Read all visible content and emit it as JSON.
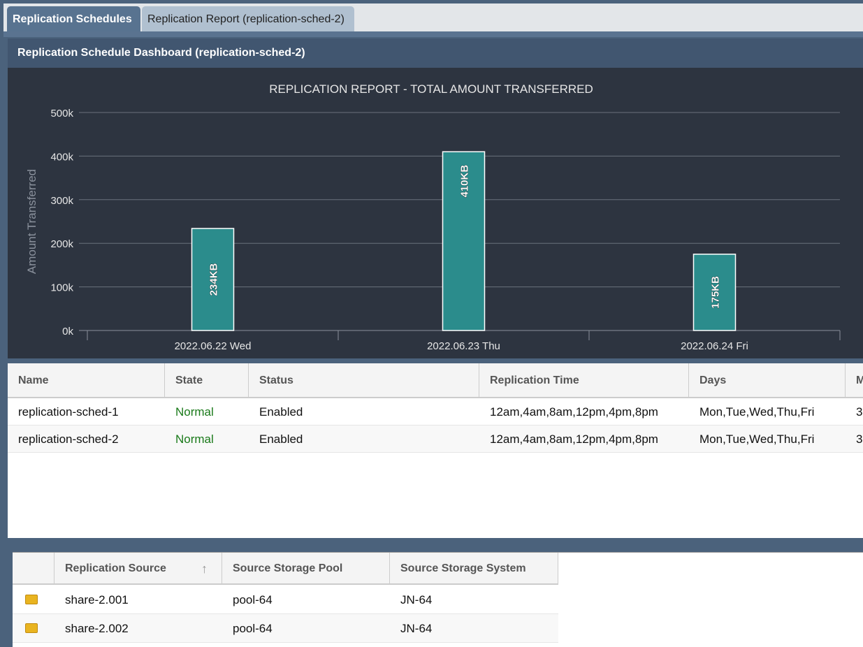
{
  "tabs": [
    {
      "label": "Replication Schedules",
      "active": true
    },
    {
      "label": "Replication Report (replication-sched-2)",
      "active": false
    }
  ],
  "panel": {
    "title": "Replication Schedule Dashboard (replication-sched-2)"
  },
  "chart_data": {
    "type": "bar",
    "title": "REPLICATION REPORT - TOTAL AMOUNT TRANSFERRED",
    "xlabel": "",
    "ylabel": "Amount Transferred",
    "categories": [
      "2022.06.22 Wed",
      "2022.06.23 Thu",
      "2022.06.24 Fri"
    ],
    "values": [
      234,
      410,
      175
    ],
    "data_labels": [
      "234KB",
      "410KB",
      "175KB"
    ],
    "unit": "KB",
    "ylim": [
      0,
      500
    ],
    "yticks": [
      "0k",
      "100k",
      "200k",
      "300k",
      "400k",
      "500k"
    ],
    "grid": true,
    "bar_color": "#2b8c8c"
  },
  "schedules": {
    "columns": [
      "Name",
      "State",
      "Status",
      "Replication Time",
      "Days",
      "M"
    ],
    "rows": [
      [
        "replication-sched-1",
        "Normal",
        "Enabled",
        "12am,4am,8am,12pm,4pm,8pm",
        "Mon,Tue,Wed,Thu,Fri",
        "3"
      ],
      [
        "replication-sched-2",
        "Normal",
        "Enabled",
        "12am,4am,8am,12pm,4pm,8pm",
        "Mon,Tue,Wed,Thu,Fri",
        "3"
      ]
    ],
    "state_color": "#1a7a1a"
  },
  "sources": {
    "columns": [
      "",
      "Replication Source",
      "Source Storage Pool",
      "Source Storage System"
    ],
    "sort": "ascending",
    "rows": [
      [
        "share-2.001",
        "pool-64",
        "JN-64"
      ],
      [
        "share-2.002",
        "pool-64",
        "JN-64"
      ]
    ]
  }
}
